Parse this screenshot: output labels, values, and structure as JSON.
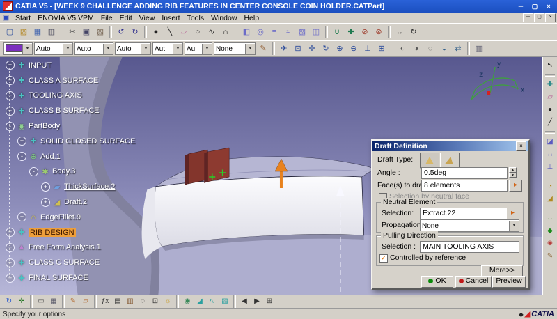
{
  "window": {
    "title": "CATIA V5 - [WEEK 9 CHALLENGE ADDING RIB FEATURES IN CENTER CONSOLE COIN HOLDER.CATPart]",
    "controls": {
      "minimize": "─",
      "maximize": "▢",
      "close": "×"
    }
  },
  "menu": {
    "doc_icon": "▣",
    "items": [
      "Start",
      "ENOVIA V5 VPM",
      "File",
      "Edit",
      "View",
      "Insert",
      "Tools",
      "Window",
      "Help"
    ],
    "mdi": {
      "minimize": "─",
      "maximize": "▢",
      "close": "×"
    }
  },
  "toolbar_row1": [
    {
      "name": "new-document",
      "glyph": "▢",
      "color": "#33539f"
    },
    {
      "name": "open-document",
      "glyph": "▨",
      "color": "#b58a2a"
    },
    {
      "name": "save-document",
      "glyph": "▦",
      "color": "#3a5fae"
    },
    {
      "name": "print",
      "glyph": "▥",
      "color": "#555566"
    },
    {
      "sep": true
    },
    {
      "name": "cut",
      "glyph": "✂",
      "color": "#444444"
    },
    {
      "name": "copy",
      "glyph": "▣",
      "color": "#444466"
    },
    {
      "name": "paste",
      "glyph": "▧",
      "color": "#776655"
    },
    {
      "sep": true
    },
    {
      "name": "undo",
      "glyph": "↺",
      "color": "#2b2b8c"
    },
    {
      "name": "redo",
      "glyph": "↻",
      "color": "#2b2b8c"
    },
    {
      "sep": true
    },
    {
      "name": "point",
      "glyph": "●",
      "color": "#222222"
    },
    {
      "name": "line",
      "glyph": "╲",
      "color": "#222222"
    },
    {
      "name": "plane",
      "glyph": "▱",
      "color": "#b4548e"
    },
    {
      "name": "circle",
      "glyph": "○",
      "color": "#222222"
    },
    {
      "name": "spline",
      "glyph": "∿",
      "color": "#222222"
    },
    {
      "name": "corner",
      "glyph": "∩",
      "color": "#222222"
    },
    {
      "sep": true
    },
    {
      "name": "extrude-surface",
      "glyph": "◧",
      "color": "#6b6bc8"
    },
    {
      "name": "revolve-surface",
      "glyph": "◎",
      "color": "#6b6bc8"
    },
    {
      "name": "offset-surface",
      "glyph": "≡",
      "color": "#6b6bc8"
    },
    {
      "name": "sweep-surface",
      "glyph": "≈",
      "color": "#6b6bc8"
    },
    {
      "name": "fill-surface",
      "glyph": "▨",
      "color": "#6b6bc8"
    },
    {
      "name": "blend-surface",
      "glyph": "◫",
      "color": "#6b6bc8"
    },
    {
      "sep": true
    },
    {
      "name": "join",
      "glyph": "∪",
      "color": "#1f7a50"
    },
    {
      "name": "healing",
      "glyph": "✚",
      "color": "#1f7a50"
    },
    {
      "name": "split",
      "glyph": "⊘",
      "color": "#a04232"
    },
    {
      "name": "trim",
      "glyph": "⊗",
      "color": "#a04232"
    },
    {
      "sep": true
    },
    {
      "name": "translate",
      "glyph": "↔",
      "color": "#333333"
    },
    {
      "name": "rotate",
      "glyph": "↻",
      "color": "#333333"
    }
  ],
  "toolbar_row2": {
    "dropdowns": [
      {
        "name": "graphic-color",
        "value": "",
        "swatch": "#7b2fbe"
      },
      {
        "name": "transparency",
        "value": "Auto"
      },
      {
        "name": "line-weight",
        "value": "Auto"
      },
      {
        "name": "line-type",
        "value": "Auto"
      },
      {
        "name": "point-symbol",
        "value": "Aut"
      },
      {
        "name": "render-mode",
        "value": "Au"
      },
      {
        "name": "layer",
        "value": "None"
      }
    ],
    "icons": [
      {
        "name": "painter",
        "glyph": "✎",
        "color": "#8a5020"
      },
      {
        "sep": true
      },
      {
        "name": "fly-mode",
        "glyph": "✈",
        "color": "#2a4a9a"
      },
      {
        "name": "fit-all-in",
        "glyph": "⊡",
        "color": "#2a4a9a"
      },
      {
        "name": "pan",
        "glyph": "✛",
        "color": "#2a4a9a"
      },
      {
        "name": "rotate-view",
        "glyph": "↻",
        "color": "#2a4a9a"
      },
      {
        "name": "zoom-in",
        "glyph": "⊕",
        "color": "#2a4a9a"
      },
      {
        "name": "zoom-out",
        "glyph": "⊖",
        "color": "#2a4a9a"
      },
      {
        "name": "normal-view",
        "glyph": "⊥",
        "color": "#2a4a9a"
      },
      {
        "name": "multi-view",
        "glyph": "⊞",
        "color": "#2a4a9a"
      },
      {
        "sep": true
      },
      {
        "name": "shading",
        "glyph": "◐",
        "color": "#555555"
      },
      {
        "name": "shading-with-edges",
        "glyph": "◑",
        "color": "#555555"
      },
      {
        "name": "wireframe",
        "glyph": "◌",
        "color": "#555555"
      },
      {
        "name": "hide-show",
        "glyph": "◒",
        "color": "#33608a"
      },
      {
        "name": "swap-visible-space",
        "glyph": "⇄",
        "color": "#33608a"
      },
      {
        "sep": true
      },
      {
        "name": "graduated-background",
        "glyph": "▥",
        "color": "#666677"
      }
    ]
  },
  "tree": {
    "items": [
      {
        "label": "INPUT",
        "level": 0,
        "marker": "+",
        "icon": "geometrical-set",
        "glyph": "✚",
        "color": "#49c2c2"
      },
      {
        "label": "CLASS A SURFACE",
        "level": 0,
        "marker": "+",
        "icon": "geometrical-set",
        "glyph": "✚",
        "color": "#49c2c2"
      },
      {
        "label": "TOOLING AXIS",
        "level": 0,
        "marker": "+",
        "icon": "geometrical-set",
        "glyph": "✚",
        "color": "#49c2c2"
      },
      {
        "label": "CLASS B SURFACE",
        "level": 0,
        "marker": "+",
        "icon": "geometrical-set",
        "glyph": "✚",
        "color": "#49c2c2"
      },
      {
        "label": "PartBody",
        "level": 0,
        "marker": "-",
        "icon": "part-body",
        "glyph": "◉",
        "color": "#8fd08f"
      },
      {
        "label": "SOLID CLOSED SURFACE",
        "level": 1,
        "marker": "+",
        "icon": "geometrical-set",
        "glyph": "✚",
        "color": "#49c2c2"
      },
      {
        "label": "Add.1",
        "level": 1,
        "marker": "-",
        "icon": "add-operation",
        "glyph": "⊕",
        "color": "#7fd07f"
      },
      {
        "label": "Body.3",
        "level": 2,
        "marker": "-",
        "icon": "body",
        "glyph": "✱",
        "color": "#9fd06f"
      },
      {
        "label": "ThickSurface.2",
        "level": 3,
        "marker": "+",
        "icon": "thick-surface",
        "glyph": "▰",
        "color": "#6fa0e0",
        "underline": true
      },
      {
        "label": "Draft.2",
        "level": 3,
        "marker": "+",
        "icon": "draft-feature",
        "glyph": "◢",
        "color": "#d0c050"
      },
      {
        "label": "EdgeFillet.9",
        "level": 1,
        "marker": "+",
        "icon": "edge-fillet",
        "glyph": "∩",
        "color": "#d0c050"
      },
      {
        "label": "RIB DESIGN",
        "level": 0,
        "marker": "+",
        "icon": "geometrical-set",
        "glyph": "✚",
        "color": "#49c2c2",
        "selected": true
      },
      {
        "label": "Free Form Analysis.1",
        "level": 0,
        "marker": "+",
        "icon": "analysis",
        "glyph": "▲",
        "color": "#c080d0"
      },
      {
        "label": "CLASS C SURFACE",
        "level": 0,
        "marker": "+",
        "icon": "geometrical-set",
        "glyph": "✚",
        "color": "#49c2c2"
      },
      {
        "label": "FINAL SURFACE",
        "level": 0,
        "marker": "+",
        "icon": "geometrical-set",
        "glyph": "✚",
        "color": "#49c2c2"
      }
    ]
  },
  "viewport": {
    "compass": {
      "x": "x",
      "y": "y",
      "z": "z"
    }
  },
  "dialog": {
    "title": "Draft Definition",
    "close_glyph": "×",
    "draft_type_label": "Draft Type:",
    "angle_label": "Angle :",
    "angle_value": "0.5deg",
    "spin_up": "▲",
    "spin_down": "▼",
    "faces_label": "Face(s) to draft:",
    "faces_value": "8 elements",
    "pick_glyph": "▸",
    "neutral_face_option": "Selection by neutral face",
    "neutral_group_title": "Neutral Element",
    "neutral_selection_label": "Selection:",
    "neutral_selection_value": "Extract.22",
    "propagation_label": "Propagation:",
    "propagation_value": "None",
    "dropdown_arrow": "▼",
    "pulling_group_title": "Pulling Direction",
    "pulling_selection_label": "Selection :",
    "pulling_selection_value": "MAIN TOOLING AXIS",
    "check_glyph": "✓",
    "controlled_option": "Controlled by reference",
    "more_label": "More>>",
    "ok_label": "OK",
    "cancel_label": "Cancel",
    "preview_label": "Preview"
  },
  "right_toolbar": [
    {
      "name": "select",
      "glyph": "↖",
      "color": "#111111"
    },
    {
      "sep": true
    },
    {
      "name": "geometrical-set",
      "glyph": "✚",
      "color": "#2a8a8a"
    },
    {
      "name": "plane",
      "glyph": "▱",
      "color": "#b4548e"
    },
    {
      "name": "point",
      "glyph": "●",
      "color": "#222222"
    },
    {
      "name": "line",
      "glyph": "╱",
      "color": "#222222"
    },
    {
      "sep": true
    },
    {
      "name": "extract",
      "glyph": "◪",
      "color": "#5a5ac0"
    },
    {
      "name": "boundary",
      "glyph": "∩",
      "color": "#5a5ac0"
    },
    {
      "name": "project",
      "glyph": "⊥",
      "color": "#5a5ac0"
    },
    {
      "sep": true
    },
    {
      "name": "shape-fillet",
      "glyph": "◔",
      "color": "#b08a20"
    },
    {
      "name": "chamfer",
      "glyph": "◢",
      "color": "#b08a20"
    },
    {
      "sep": true
    },
    {
      "name": "measure-between",
      "glyph": "↔",
      "color": "#1a8a1a"
    },
    {
      "name": "measure-item",
      "glyph": "◆",
      "color": "#1a8a1a"
    },
    {
      "name": "clash-analysis",
      "glyph": "⊗",
      "color": "#b02020"
    },
    {
      "name": "annotation",
      "glyph": "✎",
      "color": "#865c2a"
    }
  ],
  "bottom_toolbar": [
    {
      "name": "update",
      "glyph": "↻",
      "color": "#2a5ad0"
    },
    {
      "name": "axis-system",
      "glyph": "✛",
      "color": "#2a7a2a"
    },
    {
      "sep": true
    },
    {
      "name": "mean-dimension",
      "glyph": "▭",
      "color": "#555555"
    },
    {
      "name": "work-on-support",
      "glyph": "▦",
      "color": "#555566"
    },
    {
      "sep": true
    },
    {
      "name": "sketcher",
      "glyph": "✎",
      "color": "#b06020"
    },
    {
      "name": "positioned-sketch",
      "glyph": "▱",
      "color": "#b06020"
    },
    {
      "sep": true
    },
    {
      "name": "formula",
      "glyph": "ƒx",
      "color": "#333333"
    },
    {
      "name": "design-table",
      "glyph": "▤",
      "color": "#333333"
    },
    {
      "name": "catalog",
      "glyph": "▥",
      "color": "#7a4a20"
    },
    {
      "name": "search",
      "glyph": "◌",
      "color": "#333333"
    },
    {
      "name": "capture",
      "glyph": "⊡",
      "color": "#333333"
    },
    {
      "name": "light",
      "glyph": "☼",
      "color": "#c89a20"
    },
    {
      "sep": true
    },
    {
      "name": "apply-material",
      "glyph": "◉",
      "color": "#3a8a5a"
    },
    {
      "name": "draft-analysis",
      "glyph": "◢",
      "color": "#2aa0a0"
    },
    {
      "name": "curvature-analysis",
      "glyph": "∿",
      "color": "#2aa0a0"
    },
    {
      "name": "environment-mapping",
      "glyph": "▨",
      "color": "#2aa0a0"
    },
    {
      "sep": true
    },
    {
      "name": "back-view",
      "glyph": "◀",
      "color": "#333333"
    },
    {
      "name": "front-view",
      "glyph": "▶",
      "color": "#333333"
    },
    {
      "name": "window-list",
      "glyph": "⊞",
      "color": "#333333"
    }
  ],
  "status": {
    "message": "Specify your options",
    "brand": "CATIA",
    "logo_glyph": "◢",
    "ds_glyph": "◆"
  }
}
